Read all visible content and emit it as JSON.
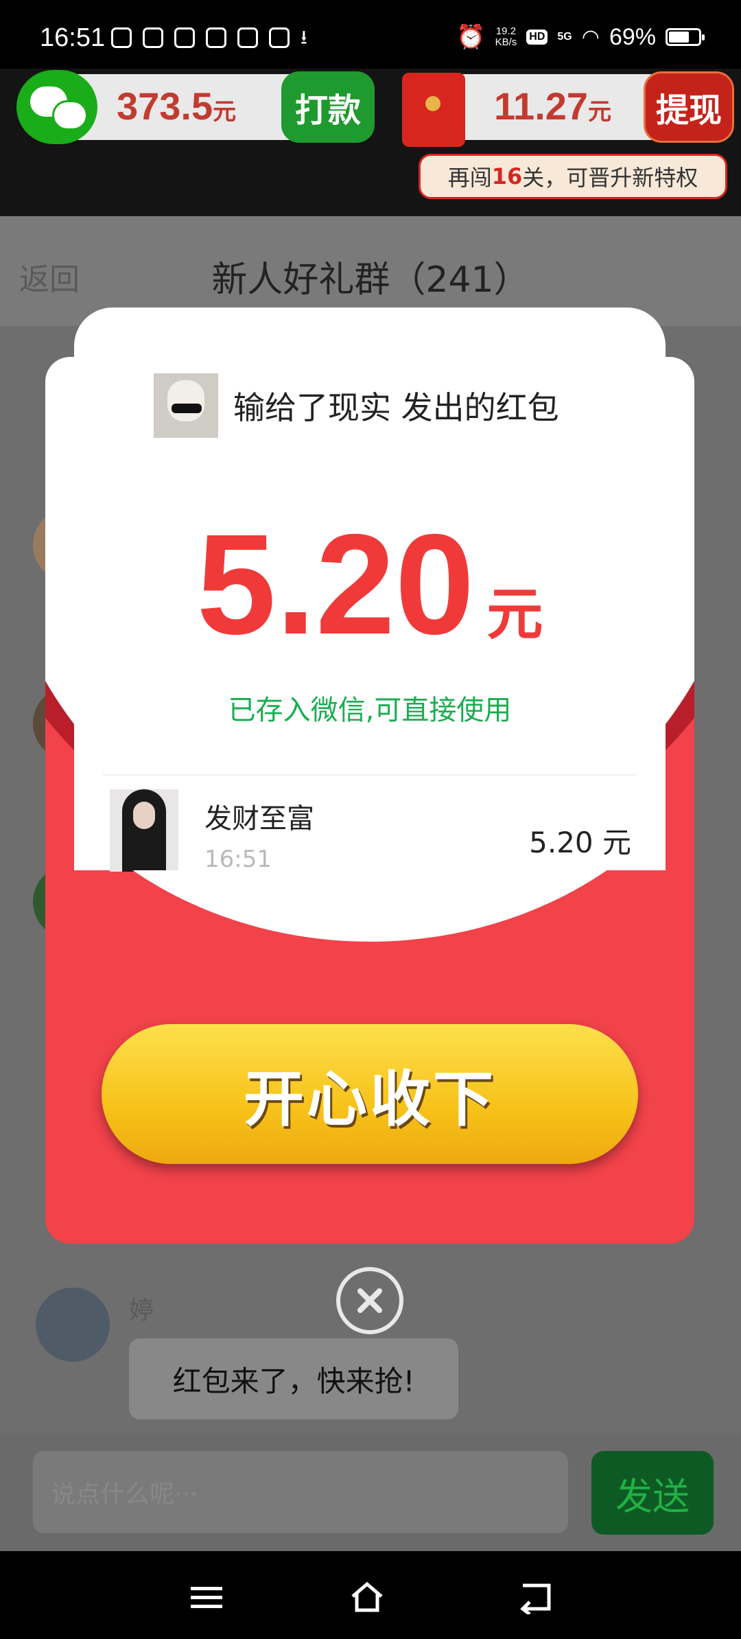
{
  "status_bar": {
    "time": "16:51",
    "net_speed_value": "19.2",
    "net_speed_unit": "KB/s",
    "hd_label": "HD",
    "network_label": "5G",
    "battery_percent": "69%",
    "battery_level": 0.69
  },
  "wallets": {
    "wechat": {
      "amount": "373.5",
      "unit": "元",
      "button": "打款"
    },
    "redpacket": {
      "amount": "11.27",
      "unit": "元",
      "button": "提现"
    }
  },
  "promo": {
    "prefix": "再闯",
    "number": "16",
    "suffix": "关，可晋升新特权"
  },
  "nav": {
    "back": "返回",
    "title": "新人好礼群（241）"
  },
  "modal": {
    "sender_line": "输给了现实 发出的红包",
    "amount": "5.20",
    "amount_unit": "元",
    "saved_note": "已存入微信,可直接使用",
    "record": {
      "name": "发财至富",
      "time": "16:51",
      "amount": "5.20 元"
    },
    "claim_button": "开心收下"
  },
  "chat": {
    "last_sender": "婷",
    "last_message": "红包来了，快来抢!"
  },
  "input": {
    "placeholder": "说点什么呢···",
    "send_button": "发送"
  },
  "colors": {
    "wechat_green": "#1aad19",
    "packet_red": "#f2424a",
    "amount_red": "#f03a3a",
    "claim_gold": "#f7c21a"
  }
}
